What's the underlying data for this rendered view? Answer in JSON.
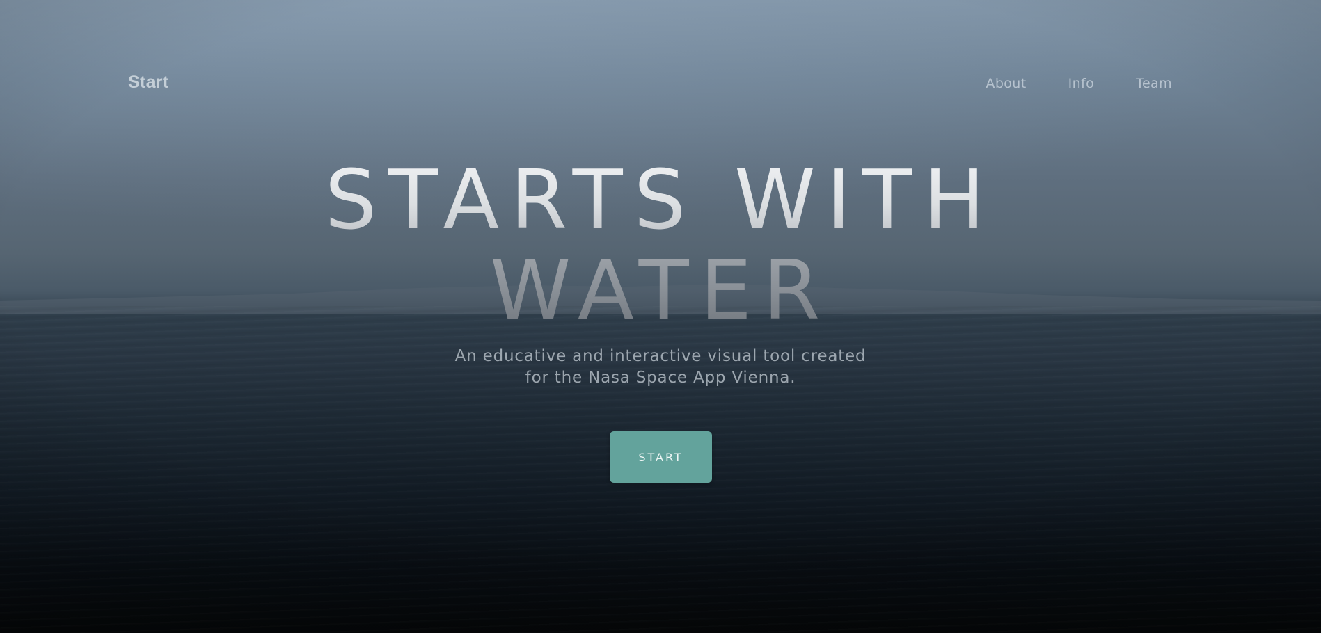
{
  "nav": {
    "brand": "Start",
    "links": [
      {
        "label": "About"
      },
      {
        "label": "Info"
      },
      {
        "label": "Team"
      }
    ]
  },
  "hero": {
    "headline_line1": "STARTS WITH",
    "headline_line2": "WATER",
    "subtitle_line1": "An educative and interactive visual tool created",
    "subtitle_line2": "for the Nasa Space App Vienna.",
    "cta_label": "START"
  },
  "colors": {
    "accent": "#63a39c",
    "sky": "#7f93a6",
    "sea": "#1e2a35"
  }
}
